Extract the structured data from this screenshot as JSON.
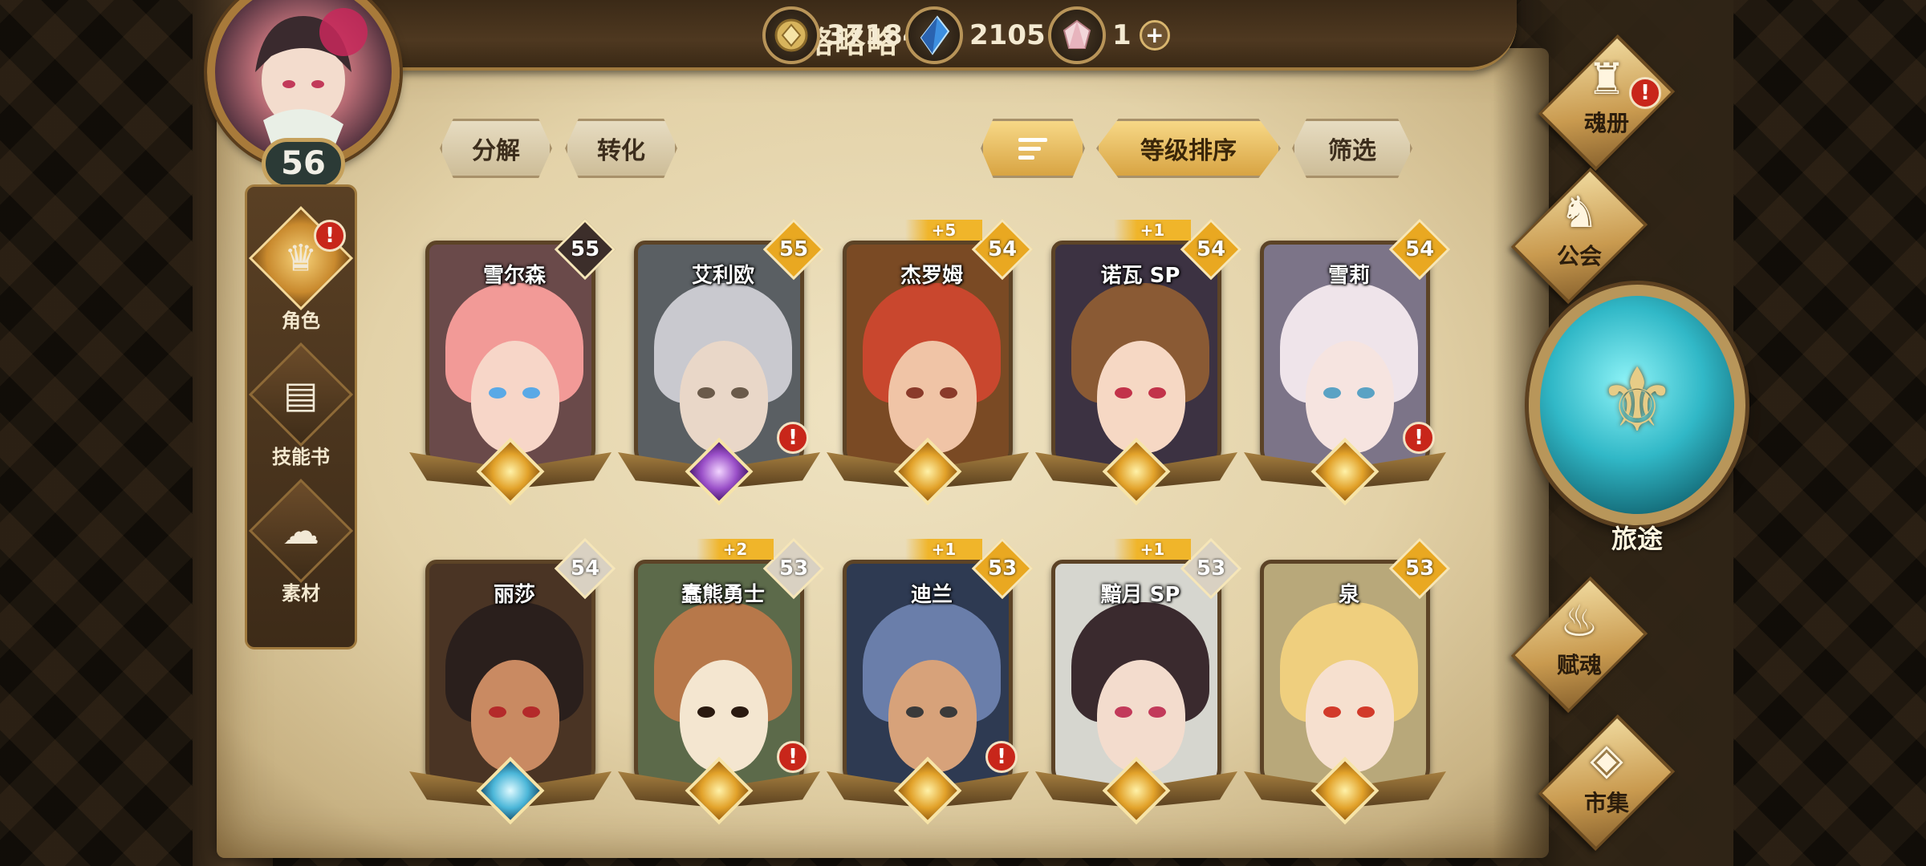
{
  "header": {
    "player_name": "略略略",
    "avatar_level": "56",
    "currencies": [
      {
        "name": "gold-coin-icon",
        "value": "371843"
      },
      {
        "name": "blue-crystal-icon",
        "value": "2105"
      },
      {
        "name": "pink-gem-icon",
        "value": "1"
      }
    ],
    "plus_label": "+"
  },
  "left_nav": {
    "items": [
      {
        "label": "角色",
        "icon": "character-icon",
        "active": true,
        "alert": "!"
      },
      {
        "label": "技能书",
        "icon": "skill-book-icon",
        "active": false
      },
      {
        "label": "素材",
        "icon": "material-icon",
        "active": false
      }
    ]
  },
  "actions": {
    "decompose": "分解",
    "convert": "转化",
    "sort_icon": "sort-icon",
    "sort_by_level": "等级排序",
    "filter": "筛选"
  },
  "cards": [
    {
      "name": "雪尔森",
      "level": "55",
      "plus": "",
      "badge": "dark",
      "crest": "gold",
      "alert": false,
      "hair": "#f29a97",
      "skin": "#f7d6c8",
      "eye": "#5aa9e6",
      "bg": "#6a4a4a"
    },
    {
      "name": "艾利欧",
      "level": "55",
      "plus": "",
      "badge": "gold",
      "crest": "purple",
      "alert": true,
      "hair": "#c9c9cf",
      "skin": "#e9d7c8",
      "eye": "#6a5a4a",
      "bg": "#5a5f63"
    },
    {
      "name": "杰罗姆",
      "level": "54",
      "plus": "+5",
      "badge": "gold",
      "crest": "gold",
      "alert": false,
      "hair": "#c9472e",
      "skin": "#f0c4a6",
      "eye": "#8a3a2a",
      "bg": "#7a4a24"
    },
    {
      "name": "诺瓦 SP",
      "level": "54",
      "plus": "+1",
      "badge": "gold",
      "crest": "gold",
      "alert": false,
      "hair": "#8a5a34",
      "skin": "#f6d8c4",
      "eye": "#c2334a",
      "bg": "#3c3242"
    },
    {
      "name": "雪莉",
      "level": "54",
      "plus": "",
      "badge": "gold",
      "crest": "gold",
      "alert": true,
      "hair": "#efe4ea",
      "skin": "#f6e4e0",
      "eye": "#5aa2c4",
      "bg": "#7c7488"
    },
    {
      "name": "丽莎",
      "level": "54",
      "plus": "",
      "badge": "light",
      "crest": "blue",
      "alert": false,
      "hair": "#2a1f1c",
      "skin": "#c98a62",
      "eye": "#b42a2a",
      "bg": "#4a3424"
    },
    {
      "name": "蠢熊勇士",
      "level": "53",
      "plus": "+2",
      "badge": "light",
      "crest": "gold",
      "alert": true,
      "hair": "#b7784a",
      "skin": "#f4e6d0",
      "eye": "#2a1a10",
      "bg": "#5c6a4a"
    },
    {
      "name": "迪兰",
      "level": "53",
      "plus": "+1",
      "badge": "gold",
      "crest": "gold",
      "alert": true,
      "hair": "#6a7eaa",
      "skin": "#d7a27a",
      "eye": "#3a3a3a",
      "bg": "#2e3a52"
    },
    {
      "name": "黯月 SP",
      "level": "53",
      "plus": "+1",
      "badge": "light",
      "crest": "gold",
      "alert": false,
      "hair": "#3a2a2e",
      "skin": "#f3dccd",
      "eye": "#c23a5a",
      "bg": "#d6d6cf"
    },
    {
      "name": "泉",
      "level": "53",
      "plus": "",
      "badge": "gold",
      "crest": "gold",
      "alert": false,
      "hair": "#efcf7e",
      "skin": "#f6e0cf",
      "eye": "#d23a2a",
      "bg": "#b8a87a"
    }
  ],
  "right_menu": {
    "soul_book": {
      "label": "魂册",
      "icon": "soul-book-icon",
      "alert": "!"
    },
    "guild": {
      "label": "公会",
      "icon": "guild-icon"
    },
    "journey": {
      "label": "旅途",
      "icon": "journey-emblem-icon"
    },
    "soul_infuse": {
      "label": "赋魂",
      "icon": "flame-icon"
    },
    "market": {
      "label": "市集",
      "icon": "gem-icon"
    }
  },
  "colors": {
    "badge_gold": "#e9a821",
    "badge_dark": "#3c2e2a",
    "badge_light": "#d9d1c2",
    "alert_red": "#c8261a"
  }
}
